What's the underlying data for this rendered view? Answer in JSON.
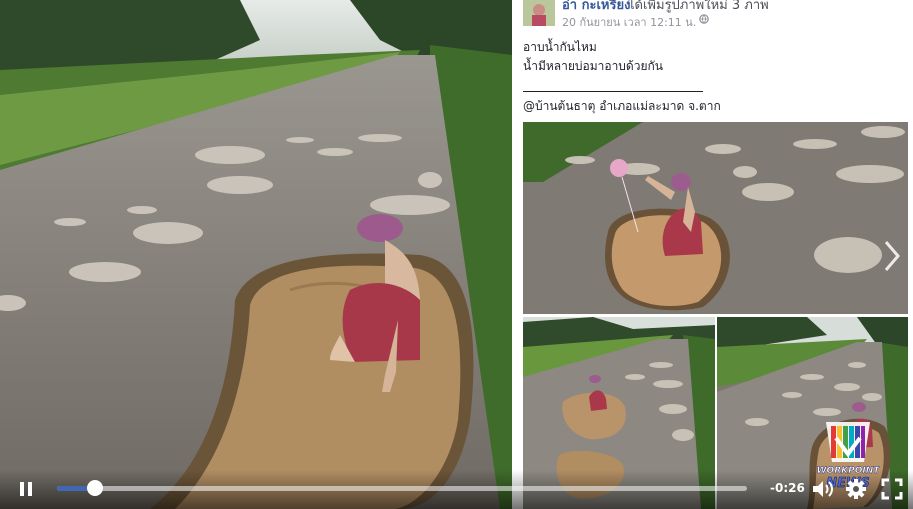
{
  "post": {
    "author_name": "อ่า กะเหรี่ยง",
    "author_action": "ได้เพิ่มรูปภาพใหม่ 3 ภาพ",
    "timestamp": "20 กันยายน เวลา 12:11 น. ·",
    "lines": [
      "อาบน้ำกันไหม",
      "น้ำมีหลายบ่อมาอาบด้วยกัน",
      "@บ้านต้นธาตุ อำเภอแม่ละมาด จ.ตาก"
    ]
  },
  "watermark": {
    "text": "WORKPOINT NEWS"
  },
  "player": {
    "time_remaining": "-0:26",
    "progress_fraction": 0.055,
    "icons": [
      "pause-icon",
      "volume-icon",
      "settings-gear-icon",
      "fullscreen-icon"
    ]
  },
  "colors": {
    "facebook_link": "#365899",
    "progress": "#4267b2"
  }
}
